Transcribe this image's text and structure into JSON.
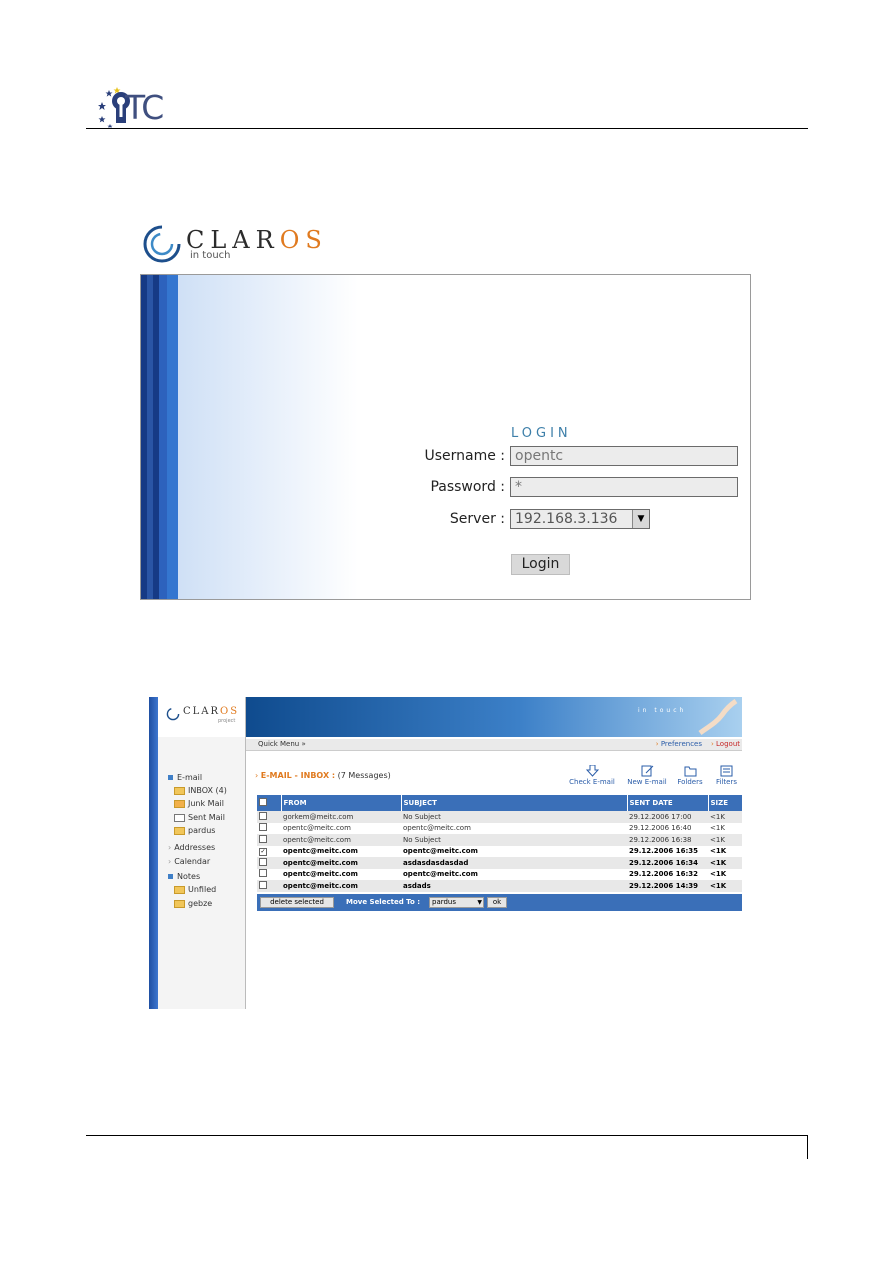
{
  "page_logo": {
    "text": "TC"
  },
  "login": {
    "brand_left": "CLAR",
    "brand_right": "OS",
    "tagline": "in touch",
    "title": "LOGIN",
    "username_label": "Username :",
    "username_value": "opentc",
    "password_label": "Password :",
    "password_value": "*",
    "server_label": "Server :",
    "server_value": "192.168.3.136",
    "login_button": "Login"
  },
  "mail": {
    "brand_left": "CLAR",
    "brand_right": "OS",
    "brand_sub": "project",
    "header_tagline": "in touch",
    "quick_menu": "Quick Menu »",
    "preferences": "Preferences",
    "logout": "Logout",
    "breadcrumb": "E-MAIL - INBOX :",
    "message_count": "(7 Messages)",
    "tools": {
      "check": "Check E-mail",
      "new": "New E-mail",
      "folders": "Folders",
      "filters": "Filters"
    },
    "sidebar": {
      "email": "E-mail",
      "inbox": "INBOX (4)",
      "junk": "Junk Mail",
      "sent": "Sent Mail",
      "pardus": "pardus",
      "addresses": "Addresses",
      "calendar": "Calendar",
      "notes": "Notes",
      "unfiled": "Unfiled",
      "gebze": "gebze"
    },
    "columns": {
      "from": "FROM",
      "subject": "SUBJECT",
      "date": "SENT DATE",
      "size": "SIZE"
    },
    "messages": [
      {
        "from": "gorkem@meitc.com",
        "subject": "No Subject",
        "date": "29.12.2006 17:00",
        "size": "<1K",
        "checked": false,
        "unread": false
      },
      {
        "from": "opentc@meitc.com",
        "subject": "opentc@meitc.com",
        "date": "29.12.2006 16:40",
        "size": "<1K",
        "checked": false,
        "unread": false
      },
      {
        "from": "opentc@meitc.com",
        "subject": "No Subject",
        "date": "29.12.2006 16:38",
        "size": "<1K",
        "checked": false,
        "unread": false
      },
      {
        "from": "opentc@meitc.com",
        "subject": "opentc@meitc.com",
        "date": "29.12.2006 16:35",
        "size": "<1K",
        "checked": true,
        "unread": true
      },
      {
        "from": "opentc@meitc.com",
        "subject": "asdasdasdasdad",
        "date": "29.12.2006 16:34",
        "size": "<1K",
        "checked": false,
        "unread": true
      },
      {
        "from": "opentc@meitc.com",
        "subject": "opentc@meitc.com",
        "date": "29.12.2006 16:32",
        "size": "<1K",
        "checked": false,
        "unread": true
      },
      {
        "from": "opentc@meitc.com",
        "subject": "asdads",
        "date": "29.12.2006 14:39",
        "size": "<1K",
        "checked": false,
        "unread": true
      }
    ],
    "delete_button": "delete selected",
    "move_label": "Move Selected To :",
    "move_value": "pardus",
    "ok_button": "ok"
  }
}
